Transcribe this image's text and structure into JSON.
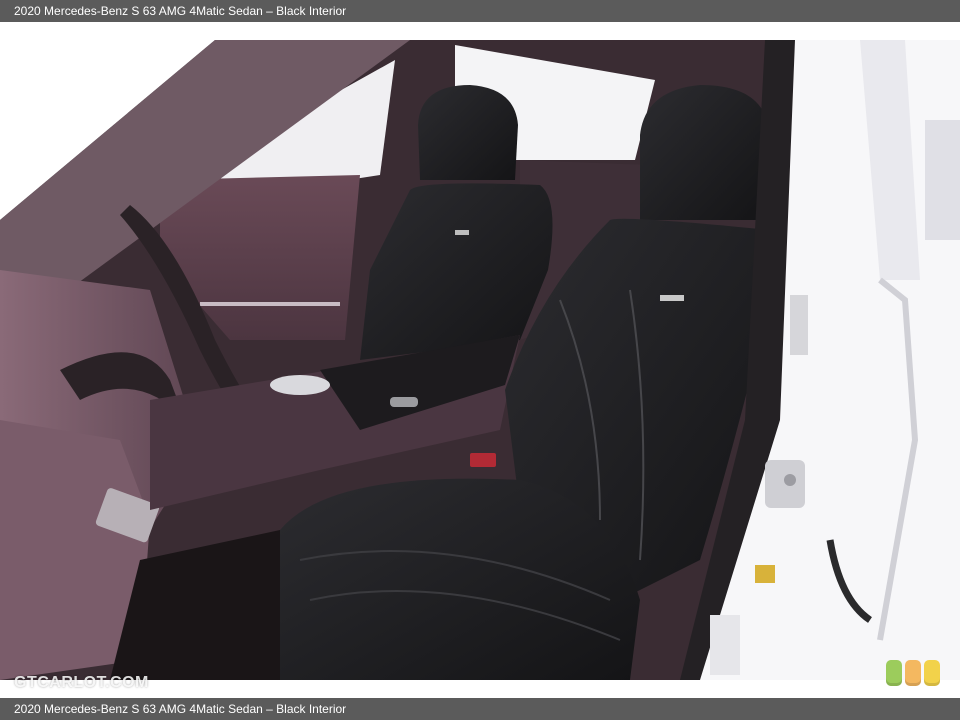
{
  "header": {
    "caption": "2020 Mercedes-Benz S 63 AMG 4Matic Sedan – Black Interior"
  },
  "footer": {
    "caption": "2020 Mercedes-Benz S 63 AMG 4Matic Sedan – Black Interior"
  },
  "photo": {
    "watermark": "GTCARLOT.COM",
    "rating_colors": [
      "#9ccc5c",
      "#f4b860",
      "#f2d24a"
    ]
  }
}
